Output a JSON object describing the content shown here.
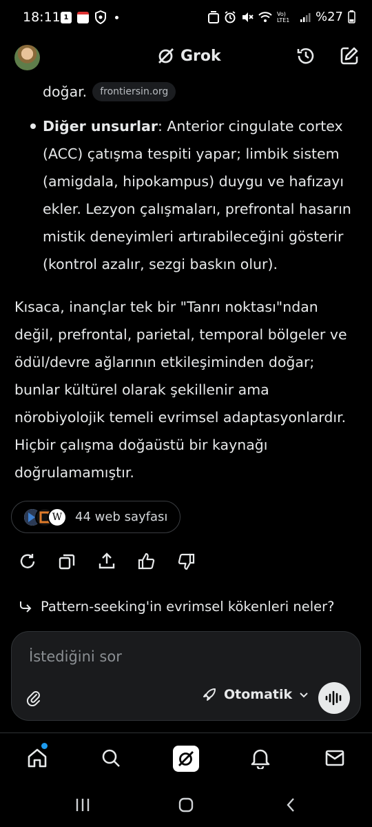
{
  "status_bar": {
    "time": "18:11",
    "calendar_day": "1",
    "network_label": "Vo) LTE1",
    "battery": "%27"
  },
  "header": {
    "title": "Grok",
    "icons": [
      "avatar",
      "grok-logo-icon",
      "history-icon",
      "edit-icon"
    ]
  },
  "content": {
    "line_tail": "doğar.",
    "source_chip": "frontiersin.org",
    "bullet": {
      "label": "Diğer unsurlar",
      "lines": [
        ": Anterior cingulate cortex",
        "(ACC) çatışma tespiti yapar; limbik sistem",
        "(amigdala, hipokampus) duygu ve hafızayı",
        "ekler. Lezyon çalışmaları, prefrontal hasarın",
        "mistik deneyimleri artırabileceğini gösterir",
        "(kontrol azalır, sezgi baskın olur)."
      ]
    },
    "summary_lines": [
      "Kısaca, inançlar tek bir \"Tanrı noktası\"ndan",
      "değil, prefrontal, parietal, temporal bölgeler ve",
      "ödül/devre ağlarının etkileşiminden doğar;",
      "bunlar kültürel olarak şekillenir ama",
      "nörobiyolojik temeli evrimsel adaptasyonlardır.",
      "Hiçbir çalışma doğaüstü bir kaynağı",
      "doğrulamamıştır."
    ]
  },
  "sources": {
    "count_label": "44 web sayfası"
  },
  "actions": [
    "regenerate-icon",
    "copy-icon",
    "share-icon",
    "thumbs-up-icon",
    "thumbs-down-icon"
  ],
  "suggestion": {
    "text": "Pattern-seeking'in evrimsel kökenleri neler?"
  },
  "composer": {
    "placeholder": "İstediğini sor",
    "mode_label": "Otomatik"
  },
  "bottom_nav": [
    "home-icon",
    "search-icon",
    "grok-icon",
    "notifications-icon",
    "messages-icon"
  ],
  "system_nav": [
    "recents-icon",
    "home-button-icon",
    "back-icon"
  ],
  "colors": {
    "background": "#000000",
    "text": "#e7e9ea",
    "muted": "#8b8f93",
    "accent": "#1d9bf0"
  }
}
